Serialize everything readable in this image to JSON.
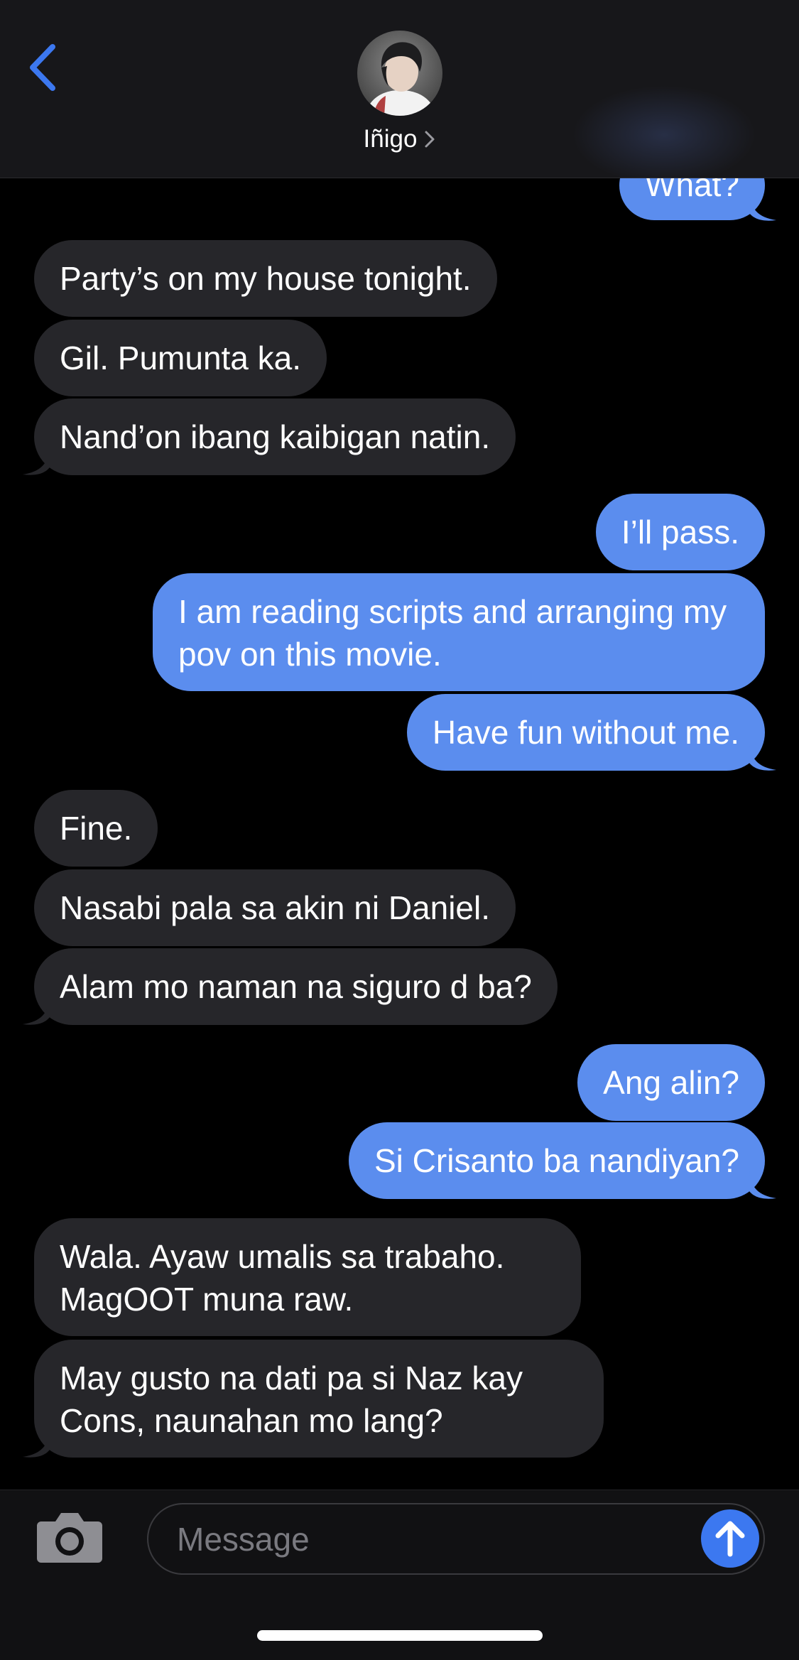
{
  "header": {
    "contact_name": "Iñigo"
  },
  "messages": [
    {
      "id": "m0",
      "direction": "outgoing",
      "text": "What?"
    },
    {
      "id": "m1",
      "direction": "incoming",
      "text": "Party’s on my house tonight."
    },
    {
      "id": "m2",
      "direction": "incoming",
      "text": "Gil. Pumunta ka."
    },
    {
      "id": "m3",
      "direction": "incoming",
      "text": "Nand’on ibang kaibigan natin."
    },
    {
      "id": "m4",
      "direction": "outgoing",
      "text": "I’ll pass."
    },
    {
      "id": "m5",
      "direction": "outgoing",
      "text": "I am reading scripts and arranging my pov on this movie."
    },
    {
      "id": "m6",
      "direction": "outgoing",
      "text": "Have fun without me."
    },
    {
      "id": "m7",
      "direction": "incoming",
      "text": "Fine."
    },
    {
      "id": "m8",
      "direction": "incoming",
      "text": "Nasabi pala sa akin ni Daniel."
    },
    {
      "id": "m9",
      "direction": "incoming",
      "text": "Alam mo naman na siguro d ba?"
    },
    {
      "id": "m10",
      "direction": "outgoing",
      "text": "Ang alin?"
    },
    {
      "id": "m11",
      "direction": "outgoing",
      "text": "Si Crisanto ba nandiyan?"
    },
    {
      "id": "m12",
      "direction": "incoming",
      "text": "Wala. Ayaw umalis sa trabaho. MagOOT muna raw."
    },
    {
      "id": "m13",
      "direction": "incoming",
      "text": "May gusto na dati pa si Naz kay Cons, naunahan mo lang?"
    }
  ],
  "composer": {
    "placeholder": "Message"
  },
  "icons": {
    "back": "chevron-left-icon",
    "name_chevron": "chevron-right-icon",
    "camera": "camera-icon",
    "send": "arrow-up-icon"
  },
  "colors": {
    "accent": "#3c78f0",
    "outgoing_bubble": "#5b8dee",
    "incoming_bubble": "#26262a",
    "background": "#000000"
  }
}
